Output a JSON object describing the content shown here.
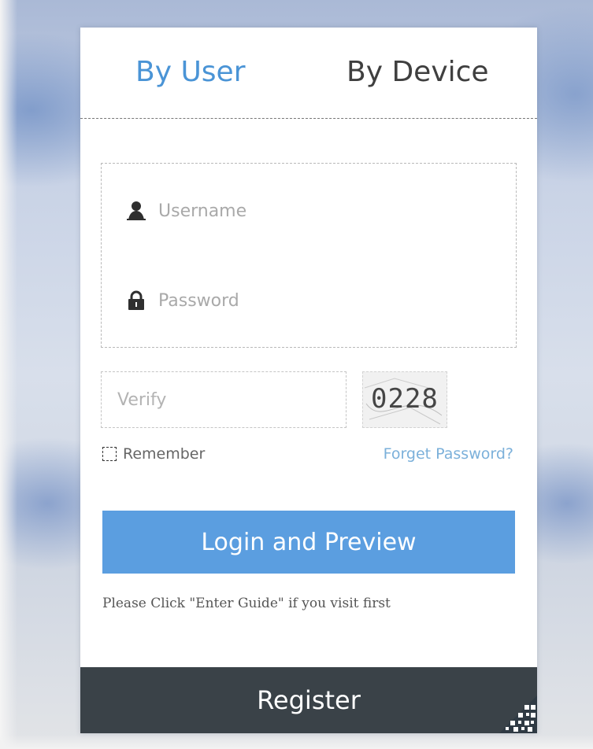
{
  "tabs": {
    "by_user": "By User",
    "by_device": "By Device"
  },
  "form": {
    "username_placeholder": "Username",
    "password_placeholder": "Password",
    "verify_placeholder": "Verify",
    "captcha_code": "0228",
    "remember_label": "Remember",
    "forget_password_label": "Forget Password?",
    "login_button_label": "Login and Preview",
    "hint_text": "Please Click \"Enter Guide\" if you visit first"
  },
  "footer": {
    "register_label": "Register",
    "corner_icon": "qr-code-icon"
  },
  "colors": {
    "accent": "#5b9ee0",
    "active_tab": "#4a94d6",
    "link": "#7bb0da",
    "register_bar": "#3a4248"
  }
}
